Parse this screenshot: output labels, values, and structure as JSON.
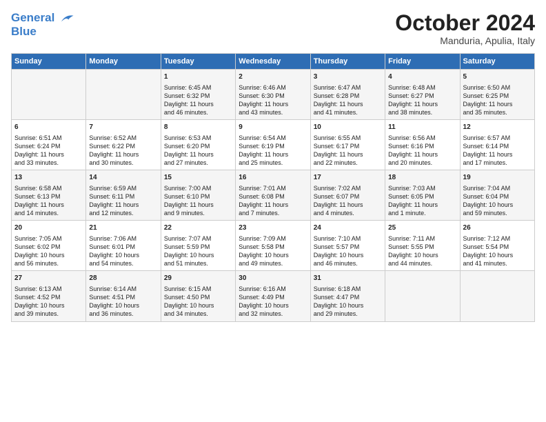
{
  "header": {
    "logo_line1": "General",
    "logo_line2": "Blue",
    "month": "October 2024",
    "location": "Manduria, Apulia, Italy"
  },
  "days_of_week": [
    "Sunday",
    "Monday",
    "Tuesday",
    "Wednesday",
    "Thursday",
    "Friday",
    "Saturday"
  ],
  "weeks": [
    [
      {
        "day": "",
        "content": ""
      },
      {
        "day": "",
        "content": ""
      },
      {
        "day": "1",
        "content": "Sunrise: 6:45 AM\nSunset: 6:32 PM\nDaylight: 11 hours\nand 46 minutes."
      },
      {
        "day": "2",
        "content": "Sunrise: 6:46 AM\nSunset: 6:30 PM\nDaylight: 11 hours\nand 43 minutes."
      },
      {
        "day": "3",
        "content": "Sunrise: 6:47 AM\nSunset: 6:28 PM\nDaylight: 11 hours\nand 41 minutes."
      },
      {
        "day": "4",
        "content": "Sunrise: 6:48 AM\nSunset: 6:27 PM\nDaylight: 11 hours\nand 38 minutes."
      },
      {
        "day": "5",
        "content": "Sunrise: 6:50 AM\nSunset: 6:25 PM\nDaylight: 11 hours\nand 35 minutes."
      }
    ],
    [
      {
        "day": "6",
        "content": "Sunrise: 6:51 AM\nSunset: 6:24 PM\nDaylight: 11 hours\nand 33 minutes."
      },
      {
        "day": "7",
        "content": "Sunrise: 6:52 AM\nSunset: 6:22 PM\nDaylight: 11 hours\nand 30 minutes."
      },
      {
        "day": "8",
        "content": "Sunrise: 6:53 AM\nSunset: 6:20 PM\nDaylight: 11 hours\nand 27 minutes."
      },
      {
        "day": "9",
        "content": "Sunrise: 6:54 AM\nSunset: 6:19 PM\nDaylight: 11 hours\nand 25 minutes."
      },
      {
        "day": "10",
        "content": "Sunrise: 6:55 AM\nSunset: 6:17 PM\nDaylight: 11 hours\nand 22 minutes."
      },
      {
        "day": "11",
        "content": "Sunrise: 6:56 AM\nSunset: 6:16 PM\nDaylight: 11 hours\nand 20 minutes."
      },
      {
        "day": "12",
        "content": "Sunrise: 6:57 AM\nSunset: 6:14 PM\nDaylight: 11 hours\nand 17 minutes."
      }
    ],
    [
      {
        "day": "13",
        "content": "Sunrise: 6:58 AM\nSunset: 6:13 PM\nDaylight: 11 hours\nand 14 minutes."
      },
      {
        "day": "14",
        "content": "Sunrise: 6:59 AM\nSunset: 6:11 PM\nDaylight: 11 hours\nand 12 minutes."
      },
      {
        "day": "15",
        "content": "Sunrise: 7:00 AM\nSunset: 6:10 PM\nDaylight: 11 hours\nand 9 minutes."
      },
      {
        "day": "16",
        "content": "Sunrise: 7:01 AM\nSunset: 6:08 PM\nDaylight: 11 hours\nand 7 minutes."
      },
      {
        "day": "17",
        "content": "Sunrise: 7:02 AM\nSunset: 6:07 PM\nDaylight: 11 hours\nand 4 minutes."
      },
      {
        "day": "18",
        "content": "Sunrise: 7:03 AM\nSunset: 6:05 PM\nDaylight: 11 hours\nand 1 minute."
      },
      {
        "day": "19",
        "content": "Sunrise: 7:04 AM\nSunset: 6:04 PM\nDaylight: 10 hours\nand 59 minutes."
      }
    ],
    [
      {
        "day": "20",
        "content": "Sunrise: 7:05 AM\nSunset: 6:02 PM\nDaylight: 10 hours\nand 56 minutes."
      },
      {
        "day": "21",
        "content": "Sunrise: 7:06 AM\nSunset: 6:01 PM\nDaylight: 10 hours\nand 54 minutes."
      },
      {
        "day": "22",
        "content": "Sunrise: 7:07 AM\nSunset: 5:59 PM\nDaylight: 10 hours\nand 51 minutes."
      },
      {
        "day": "23",
        "content": "Sunrise: 7:09 AM\nSunset: 5:58 PM\nDaylight: 10 hours\nand 49 minutes."
      },
      {
        "day": "24",
        "content": "Sunrise: 7:10 AM\nSunset: 5:57 PM\nDaylight: 10 hours\nand 46 minutes."
      },
      {
        "day": "25",
        "content": "Sunrise: 7:11 AM\nSunset: 5:55 PM\nDaylight: 10 hours\nand 44 minutes."
      },
      {
        "day": "26",
        "content": "Sunrise: 7:12 AM\nSunset: 5:54 PM\nDaylight: 10 hours\nand 41 minutes."
      }
    ],
    [
      {
        "day": "27",
        "content": "Sunrise: 6:13 AM\nSunset: 4:52 PM\nDaylight: 10 hours\nand 39 minutes."
      },
      {
        "day": "28",
        "content": "Sunrise: 6:14 AM\nSunset: 4:51 PM\nDaylight: 10 hours\nand 36 minutes."
      },
      {
        "day": "29",
        "content": "Sunrise: 6:15 AM\nSunset: 4:50 PM\nDaylight: 10 hours\nand 34 minutes."
      },
      {
        "day": "30",
        "content": "Sunrise: 6:16 AM\nSunset: 4:49 PM\nDaylight: 10 hours\nand 32 minutes."
      },
      {
        "day": "31",
        "content": "Sunrise: 6:18 AM\nSunset: 4:47 PM\nDaylight: 10 hours\nand 29 minutes."
      },
      {
        "day": "",
        "content": ""
      },
      {
        "day": "",
        "content": ""
      }
    ]
  ]
}
